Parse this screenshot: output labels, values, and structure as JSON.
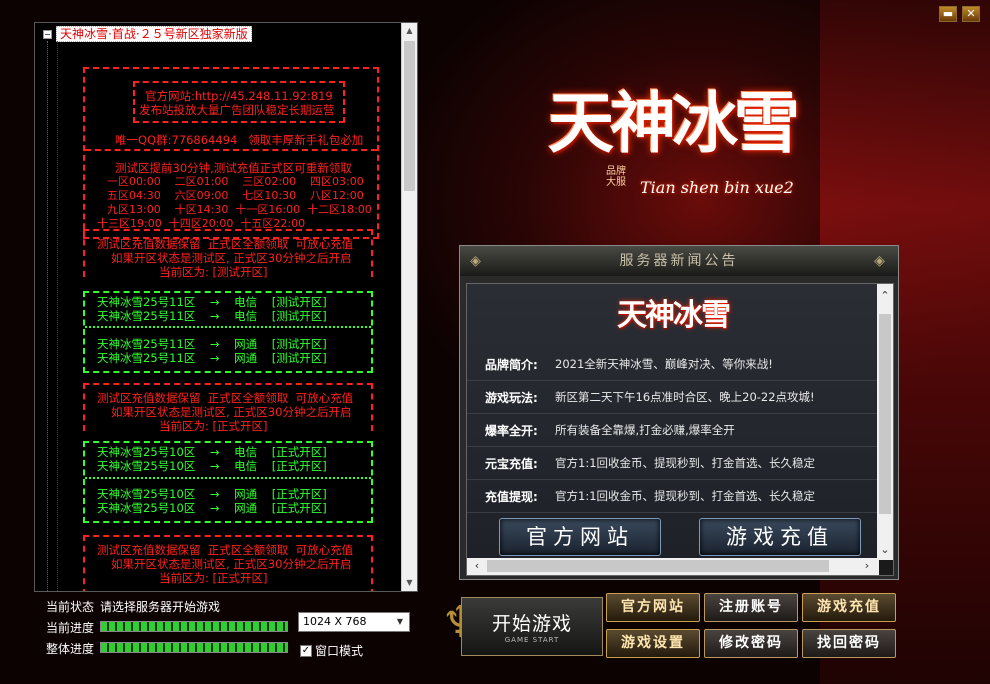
{
  "window": {
    "minimize": "▬",
    "close": "✕"
  },
  "tree": {
    "root": "天神冰雪·首战·２５号新区独家新版",
    "lines": [
      "┏━━━━━━━━━━━━━━━━━━┓",
      "官方网站:http://45.248.11.92:819",
      "发布站投放大量广告团队稳定长期运营",
      "唯一QQ群:776864494   领取丰厚新手礼包必加",
      "测试区提前30分钟,测试充值正式区可重新领取",
      "一区00:00    二区01:00    三区02:00    四区03:00",
      "五区04:30    六区09:00    七区10:30    八区12:00",
      "九区13:00    十区14:30  十一区16:00  十二区18:00",
      "十三区19:00  十四区20:00  十五区22:00",
      "测试区充值数据保留  正式区全额领取  可放心充值",
      "如果开区状态是测试区, 正式区30分钟之后开启",
      "当前区为: [测试开区]",
      "天神冰雪25号11区    →    电信    [测试开区]",
      "天神冰雪25号11区    →    电信    [测试开区]",
      "天神冰雪25号11区    →    网通    [测试开区]",
      "天神冰雪25号11区    →    网通    [测试开区]",
      "测试区充值数据保留  正式区全额领取  可放心充值",
      "如果开区状态是测试区, 正式区30分钟之后开启",
      "当前区为: [正式开区]",
      "天神冰雪25号10区    →    电信    [正式开区]",
      "天神冰雪25号10区    →    电信    [正式开区]",
      "天神冰雪25号10区    →    网通    [正式开区]",
      "天神冰雪25号10区    →    网通    [正式开区]",
      "测试区充值数据保留  正式区全额领取  可放心充值",
      "如果开区状态是测试区, 正式区30分钟之后开启",
      "当前区为: [正式开区]"
    ]
  },
  "status": {
    "current_state_label": "当前状态",
    "current_state_value": "请选择服务器开始游戏",
    "current_progress_label": "当前进度",
    "overall_progress_label": "整体进度",
    "current_progress": 1.0,
    "overall_progress": 1.0,
    "resolution": "1024 X 768",
    "window_mode_label": "窗口模式",
    "window_mode_checked": true
  },
  "logo": {
    "title": "天神冰雪",
    "tag1": "品牌",
    "tag2": "大服",
    "latin": "Tian shen bin xue2"
  },
  "news": {
    "title": "服务器新闻公告",
    "logo": "天神冰雪",
    "rows": [
      {
        "k": "品牌简介:",
        "v": "2021全新天神冰雪、巅峰对决、等你来战!"
      },
      {
        "k": "游戏玩法:",
        "v": "新区第二天下午16点准时合区、晚上20-22点攻城!"
      },
      {
        "k": "爆率全开:",
        "v": "所有装备全靠爆,打金必赚,爆率全开"
      },
      {
        "k": "元宝充值:",
        "v": "官方1:1回收金币、提现秒到、打金首选、长久稳定"
      },
      {
        "k": "充值提现:",
        "v": "官方1:1回收金币、提现秒到、打金首选、长久稳定"
      }
    ],
    "btn_site": "官方网站",
    "btn_recharge": "游戏充值"
  },
  "actions": {
    "start": "开始游戏",
    "start_sub": "GAME START",
    "site": "官方网站",
    "register": "注册账号",
    "recharge": "游戏充值",
    "settings": "游戏设置",
    "change_pwd": "修改密码",
    "recover_pwd": "找回密码"
  }
}
